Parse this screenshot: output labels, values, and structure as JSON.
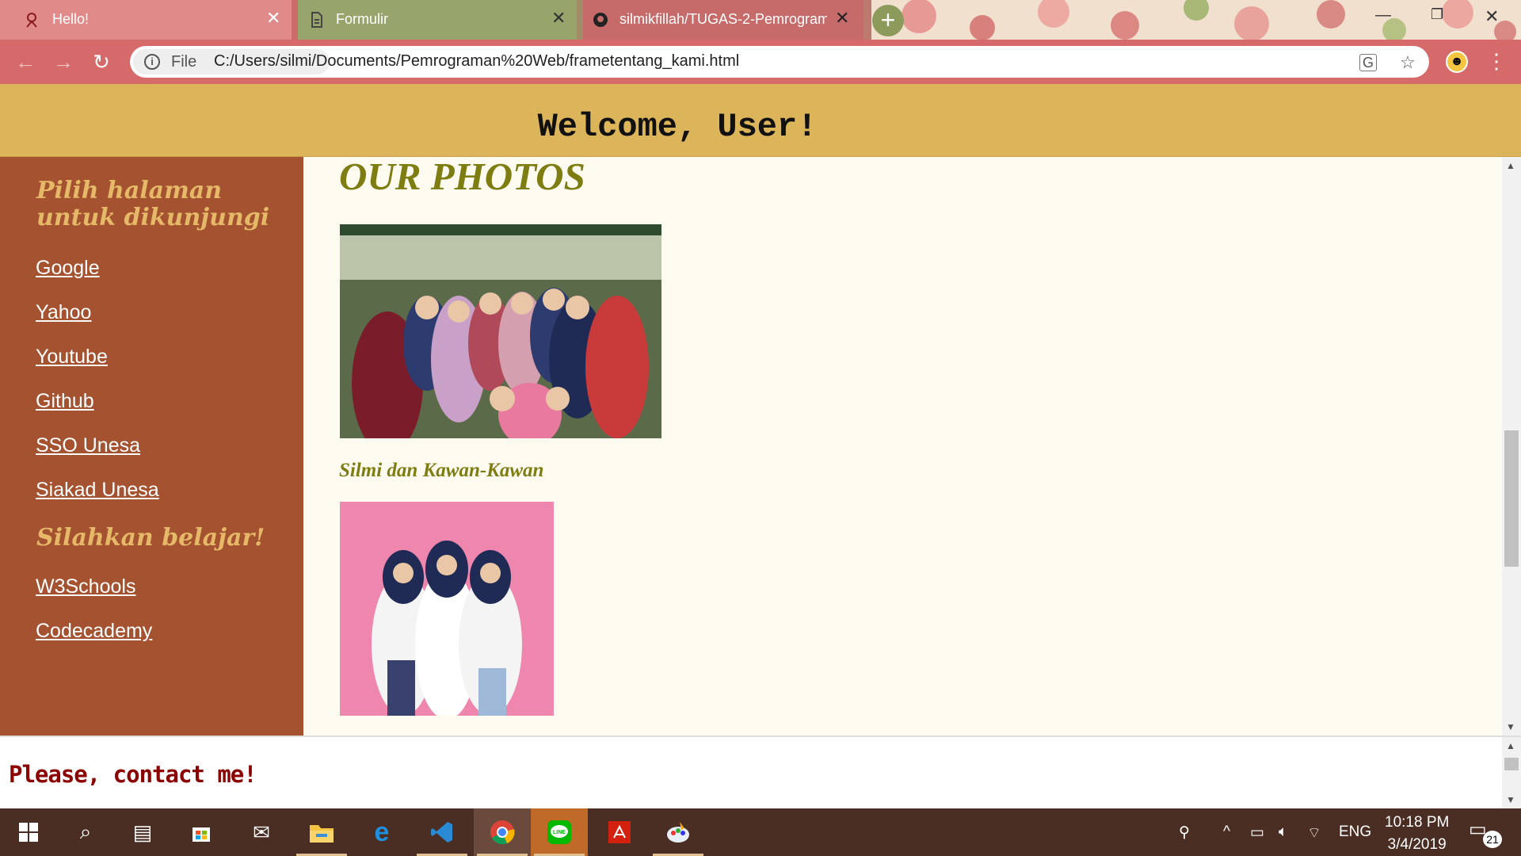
{
  "browser": {
    "tabs": [
      {
        "title": "Hello!",
        "icon": "person-icon",
        "active": true
      },
      {
        "title": "Formulir",
        "icon": "document-icon"
      },
      {
        "title": "silmikfillah/TUGAS-2-Pemrogram",
        "icon": "github-icon"
      }
    ],
    "address": {
      "security_label": "File",
      "url": "C:/Users/silmi/Documents/Pemrograman%20Web/frametentang_kami.html"
    }
  },
  "page": {
    "header_title": "Welcome, User!",
    "sidebar": {
      "heading1": "Pilih halaman untuk dikunjungi",
      "links1": [
        "Google",
        "Yahoo",
        "Youtube",
        "Github",
        "SSO Unesa",
        "Siakad Unesa"
      ],
      "heading2": "Silahkan belajar!",
      "links2": [
        "W3Schools",
        "Codecademy"
      ]
    },
    "content": {
      "title": "OUR PHOTOS",
      "photo1_caption": "Silmi dan Kawan-Kawan"
    },
    "footer_text": "Please, contact me!"
  },
  "taskbar": {
    "apps": [
      "start-icon",
      "search-icon",
      "task-view-icon",
      "store-icon",
      "mail-icon",
      "file-explorer-icon",
      "edge-icon",
      "vscode-icon",
      "chrome-icon",
      "line-icon",
      "acrobat-icon",
      "paint-icon"
    ],
    "language": "ENG",
    "time": "10:18 PM",
    "date": "3/4/2019",
    "notification_count": "21"
  },
  "colors": {
    "header_bg": "#dcb55a",
    "sidebar_bg": "#a55230",
    "sidebar_heading": "#e5b968",
    "content_title": "#7d7d12",
    "footer_text": "#8b0000"
  }
}
